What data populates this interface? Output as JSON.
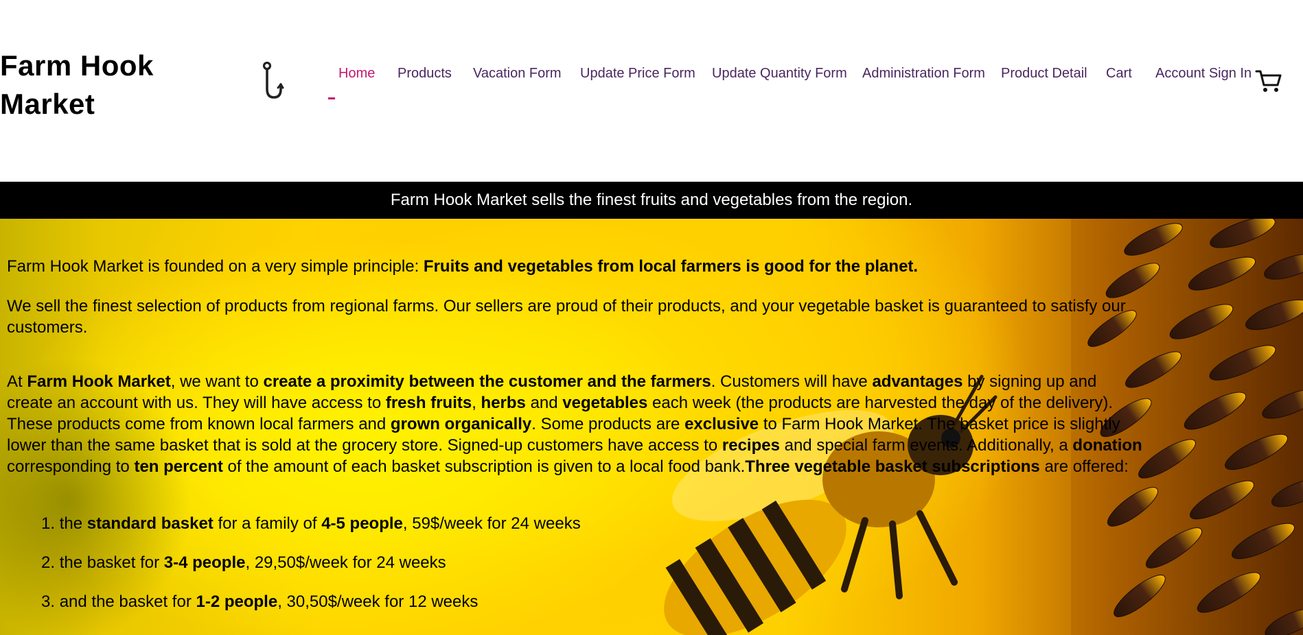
{
  "header": {
    "brand": "Farm Hook Market",
    "nav": [
      {
        "label": "Home",
        "active": true
      },
      {
        "label": "Products",
        "active": false
      },
      {
        "label": "Vacation Form",
        "active": false
      },
      {
        "label": "Update Price Form",
        "active": false
      },
      {
        "label": "Update Quantity Form",
        "active": false
      },
      {
        "label": "Administration Form",
        "active": false
      },
      {
        "label": "Product Detail",
        "active": false
      },
      {
        "label": "Cart",
        "active": false
      },
      {
        "label": "Account Sign In",
        "active": false
      }
    ],
    "icons": {
      "logo": "hook-icon",
      "cart": "cart-icon"
    }
  },
  "banner": {
    "text": "Farm Hook Market sells the finest fruits and vegetables from the region."
  },
  "hero": {
    "background": "sunflower-and-bee-photo",
    "p1": {
      "intro": "Farm Hook Market is founded on a very simple principle: ",
      "bold": "Fruits and vegetables from local farmers is good for the planet."
    },
    "p2": "We sell the finest selection of products from regional farms. Our sellers are proud of their products, and your vegetable basket is guaranteed to satisfy our customers.",
    "p3": {
      "t1": "At ",
      "b1": "Farm Hook Market",
      "t2": ", we want to ",
      "b2": "create a proximity between the customer and the farmers",
      "t3": ". Customers will have ",
      "b3": "advantages",
      "t4": " by signing up and create an account with us. They will have access to ",
      "b4": "fresh fruits",
      "t5": ", ",
      "b5": "herbs",
      "t6": " and ",
      "b6": "vegetables",
      "t7": " each week (the products are harvested the day of the delivery). These products come from known local farmers and ",
      "b7": "grown organically",
      "t8": ". Some products are ",
      "b8": "exclusive",
      "t9": " to Farm Hook Market. The basket price is slightly lower than the same basket that is sold at the grocery store. Signed-up customers have access to ",
      "b9": "recipes",
      "t10": " and special farm events. Additionally, a ",
      "b10": "donation",
      "t11": " corresponding to ",
      "b11": "ten percent",
      "t12": " of the amount of each basket subscription is given to a local food bank.",
      "b12": "Three vegetable basket subscriptions",
      "t13": " are offered:"
    },
    "list": [
      {
        "num": "1.",
        "t1": "the ",
        "b1": "standard basket",
        "t2": " for a family of ",
        "b2": "4-5 people",
        "t3": ", 59$/week for 24 weeks"
      },
      {
        "num": "2.",
        "t1": "the basket for ",
        "b1": "3-4 people",
        "t2": ", 29,50$/week for 24 weeks",
        "b2": "",
        "t3": ""
      },
      {
        "num": "3.",
        "t1": "and the basket for ",
        "b1": "1-2 people",
        "t2": ", 30,50$/week for 12 weeks",
        "b2": "",
        "t3": ""
      }
    ]
  }
}
